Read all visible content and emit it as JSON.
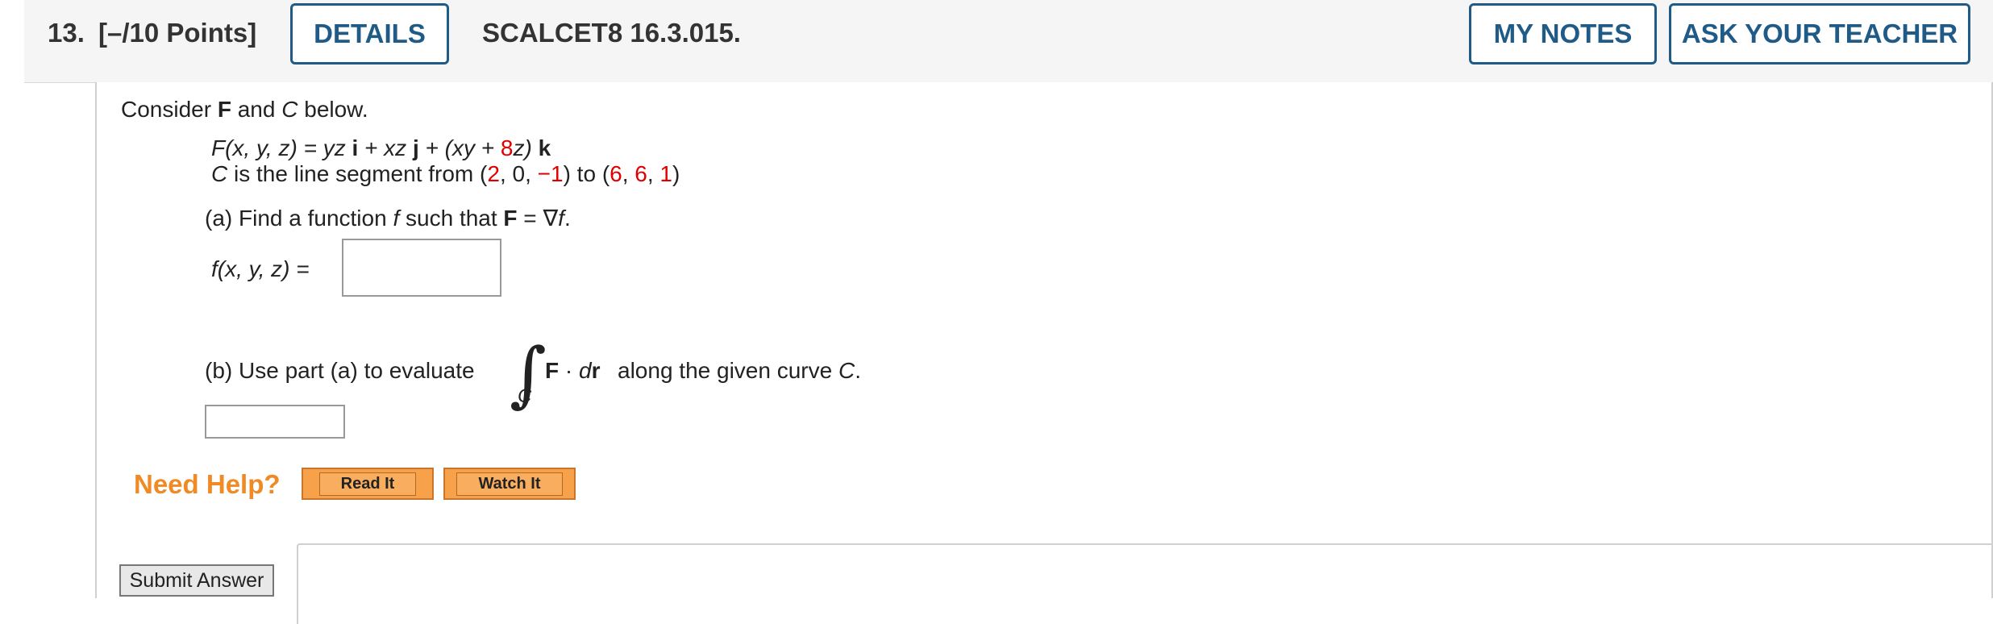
{
  "header": {
    "question_number": "13.",
    "points": "[–/10 Points]",
    "details_label": "DETAILS",
    "question_code": "SCALCET8 16.3.015.",
    "my_notes_label": "MY NOTES",
    "ask_teacher_label": "ASK YOUR TEACHER"
  },
  "problem": {
    "intro_1": "Consider ",
    "intro_F": "F",
    "intro_2": " and ",
    "intro_C": "C",
    "intro_3": " below.",
    "field_lhs": "F(x, y, z) = yz ",
    "field_i": "i",
    "field_mid1": " + xz ",
    "field_j": "j",
    "field_mid2": " + (xy + ",
    "field_coef": "8",
    "field_mid3": "z) ",
    "field_k": "k",
    "curve_text_1": "C",
    "curve_text_2": " is the line segment from (",
    "start_x": "2",
    "start_sep1": ", 0, ",
    "start_z": "−1",
    "curve_text_3": ") to (",
    "end_x": "6",
    "end_sep1": ", ",
    "end_y": "6",
    "end_sep2": ", ",
    "end_z": "1",
    "curve_text_4": ")"
  },
  "part_a": {
    "prompt_1": "(a) Find a function ",
    "prompt_f": "f",
    "prompt_2": " such that ",
    "prompt_F": "F",
    "prompt_3": " = ∇",
    "prompt_f2": "f",
    "prompt_4": ".",
    "answer_label": "f(x, y, z) =",
    "answer_value": ""
  },
  "part_b": {
    "prompt": "(b) Use part (a) to evaluate",
    "integral_symbol": "∫",
    "integral_sub": "C",
    "integrand_F": "F",
    "integrand_dot": " · ",
    "integrand_d": "d",
    "integrand_r": "r",
    "tail_1": "along the given curve ",
    "tail_C": "C",
    "tail_2": ".",
    "answer_value": ""
  },
  "help": {
    "label": "Need Help?",
    "read_it": "Read It",
    "watch_it": "Watch It"
  },
  "submit_label": "Submit Answer",
  "colors": {
    "accent": "#1f5b86",
    "highlight_red": "#e00000",
    "need_help": "#f08a24",
    "help_button": "#f7a14a"
  }
}
